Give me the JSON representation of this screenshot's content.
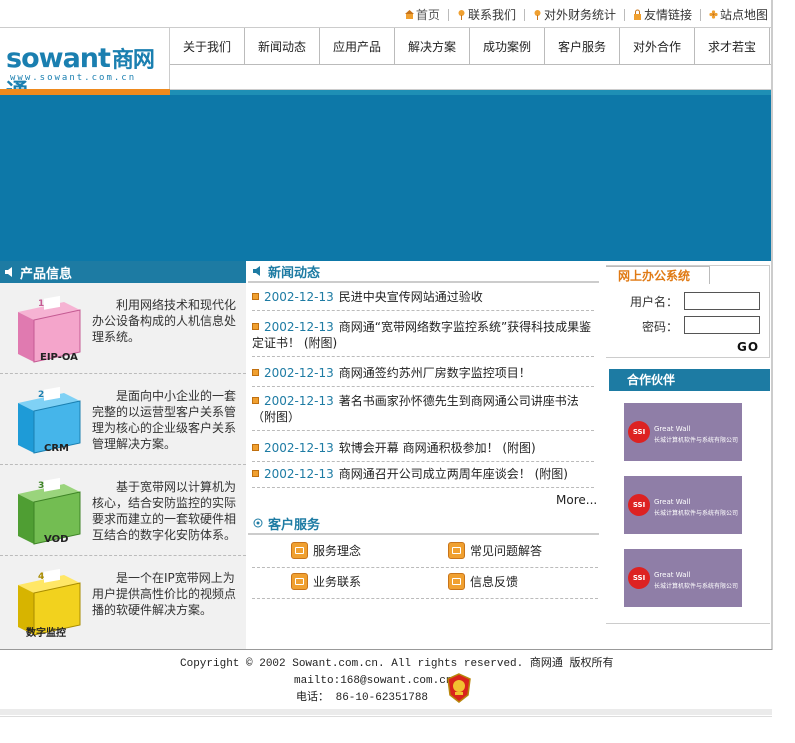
{
  "topbar": {
    "links": [
      {
        "label": "首页",
        "icon": "home-icon"
      },
      {
        "label": "联系我们",
        "icon": "pin-icon"
      },
      {
        "label": "对外财务统计",
        "icon": "pin-icon"
      },
      {
        "label": "友情链接",
        "icon": "lock-icon"
      },
      {
        "label": "站点地图",
        "icon": "flower-icon"
      }
    ]
  },
  "logo": {
    "brand": "sowant",
    "brand_cn": "商网通",
    "url": "www.sowant.com.cn"
  },
  "nav": [
    "关于我们",
    "新闻动态",
    "应用产品",
    "解决方案",
    "成功案例",
    "客户服务",
    "对外合作",
    "求才若宝"
  ],
  "products": {
    "title": "产品信息",
    "items": [
      {
        "box_label": "EIP-OA",
        "box_num": "1",
        "desc": "利用网络技术和现代化办公设备构成的人机信息处理系统。"
      },
      {
        "box_label": "CRM",
        "box_num": "2",
        "desc": "是面向中小企业的一套完整的以运营型客户关系管理为核心的企业级客户关系管理解决方案。"
      },
      {
        "box_label": "VOD",
        "box_num": "3",
        "desc": "基于宽带网以计算机为核心，结合安防监控的实际要求而建立的一套软硬件相互结合的数字化安防体系。"
      },
      {
        "box_label": "数字监控",
        "box_num": "4",
        "desc": "是一个在IP宽带网上为用户提供高性价比的视频点播的软硬件解决方案。"
      }
    ]
  },
  "news": {
    "title": "新闻动态",
    "items": [
      {
        "date": "2002-12-13",
        "title": "民进中央宣传网站通过验收"
      },
      {
        "date": "2002-12-13",
        "title": "商网通“宽带网络数字监控系统”获得科技成果鉴定证书！  (附图)"
      },
      {
        "date": "2002-12-13",
        "title": "商网通签约苏州厂房数字监控项目！"
      },
      {
        "date": "2002-12-13",
        "title": "著名书画家孙怀德先生到商网通公司讲座书法（附图）"
      },
      {
        "date": "2002-12-13",
        "title": "软博会开幕 商网通积极参加！  (附图)"
      },
      {
        "date": "2002-12-13",
        "title": "商网通召开公司成立两周年座谈会！  (附图)"
      }
    ],
    "more": "More..."
  },
  "service": {
    "title": "客户服务",
    "items": [
      "服务理念",
      "常见问题解答",
      "业务联系",
      "信息反馈"
    ]
  },
  "login": {
    "title": "网上办公系统",
    "user_label": "用户名：",
    "pass_label": "密码：",
    "user_value": "",
    "pass_value": "",
    "go": "GO"
  },
  "partners": {
    "title": "合作伙伴",
    "items": [
      {
        "mark": "SSI",
        "line1": "Great Wall",
        "line2": "长城计算机软件与系统有限公司"
      },
      {
        "mark": "SSI",
        "line1": "Great Wall",
        "line2": "长城计算机软件与系统有限公司"
      },
      {
        "mark": "SSI",
        "line1": "Great Wall",
        "line2": "长城计算机软件与系统有限公司"
      }
    ]
  },
  "footer": {
    "copyright": "Copyright © 2002 Sowant.com.cn. All rights reserved. 商网通 版权所有",
    "mail": "mailto:168@sowant.com.cn",
    "tel_label": "电话：",
    "tel": "86-10-62351788"
  },
  "colors": {
    "accent": "#1d7ba3",
    "orange": "#ee8a1e",
    "banner": "#0d78a8"
  }
}
